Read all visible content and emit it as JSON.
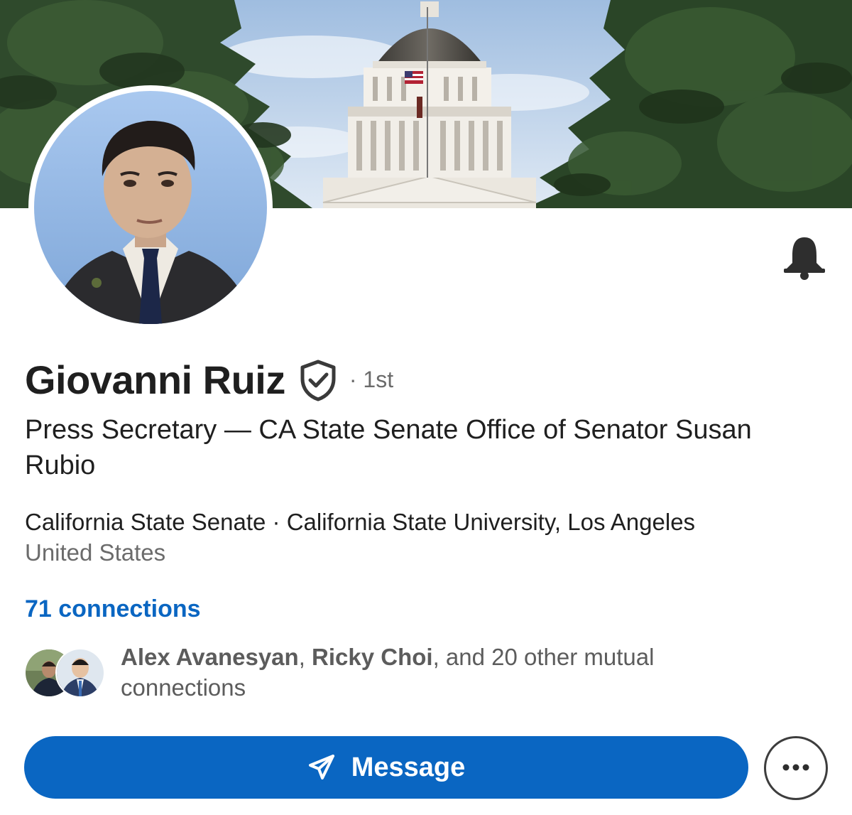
{
  "profile": {
    "name": "Giovanni Ruiz",
    "degree": "· 1st",
    "headline": "Press Secretary — CA State Senate Office of Senator Susan Rubio",
    "organizations": "California State Senate · California State University, Los Angeles",
    "location": "United States",
    "connections_label": "71 connections"
  },
  "mutual": {
    "name_1": "Alex Avanesyan",
    "separator": ", ",
    "name_2": "Ricky Choi",
    "suffix": ", and 20 other mutual connections"
  },
  "actions": {
    "message_label": "Message"
  },
  "icons": {
    "verified": "shield-check-icon",
    "bell": "bell-icon",
    "send": "send-icon",
    "more": "more-horizontal-icon"
  },
  "colors": {
    "accent": "#0a66c2",
    "text_primary": "#1f1f1f",
    "text_secondary": "#6b6b6b"
  }
}
